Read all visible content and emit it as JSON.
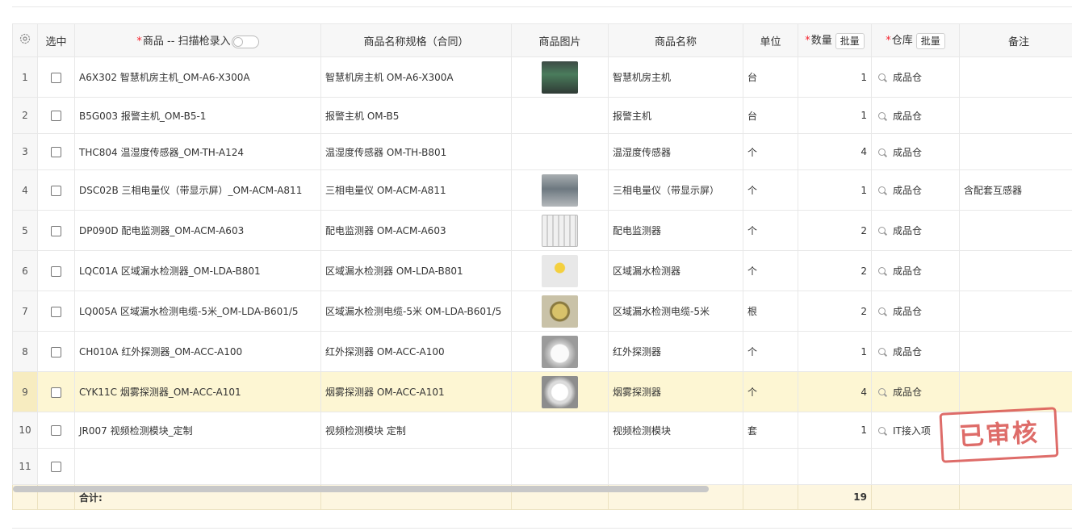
{
  "table": {
    "headers": {
      "select": "选中",
      "product_label": "商品 -- 扫描枪录入",
      "spec": "商品名称规格（合同）",
      "image": "商品图片",
      "name": "商品名称",
      "unit": "单位",
      "qty": "数量",
      "warehouse": "仓库",
      "note": "备注",
      "batch_label": "批量",
      "required_mark": "*"
    },
    "rows": [
      {
        "idx": "1",
        "product": "A6X302 智慧机房主机_OM-A6-X300A",
        "spec": "智慧机房主机 OM-A6-X300A",
        "image": "a6",
        "name": "智慧机房主机",
        "unit": "台",
        "qty": "1",
        "warehouse": "成品仓",
        "note": "",
        "checked": false
      },
      {
        "idx": "2",
        "product": "B5G003 报警主机_OM-B5-1",
        "spec": "报警主机 OM-B5",
        "image": "",
        "name": "报警主机",
        "unit": "台",
        "qty": "1",
        "warehouse": "成品仓",
        "note": "",
        "checked": false
      },
      {
        "idx": "3",
        "product": "THC804 温湿度传感器_OM-TH-A124",
        "spec": "温湿度传感器 OM-TH-B801",
        "image": "",
        "name": "温湿度传感器",
        "unit": "个",
        "qty": "4",
        "warehouse": "成品仓",
        "note": "",
        "checked": false
      },
      {
        "idx": "4",
        "product": "DSC02B 三相电量仪（带显示屏）_OM-ACM-A811",
        "spec": "三相电量仪 OM-ACM-A811",
        "image": "acm",
        "name": "三相电量仪（带显示屏）",
        "unit": "个",
        "qty": "1",
        "warehouse": "成品仓",
        "note": "含配套互感器",
        "checked": false
      },
      {
        "idx": "5",
        "product": "DP090D 配电监测器_OM-ACM-A603",
        "spec": "配电监测器 OM-ACM-A603",
        "image": "a603",
        "name": "配电监测器",
        "unit": "个",
        "qty": "2",
        "warehouse": "成品仓",
        "note": "",
        "checked": false
      },
      {
        "idx": "6",
        "product": "LQC01A 区域漏水检测器_OM-LDA-B801",
        "spec": "区域漏水检测器 OM-LDA-B801",
        "image": "b801",
        "name": "区域漏水检测器",
        "unit": "个",
        "qty": "2",
        "warehouse": "成品仓",
        "note": "",
        "checked": false
      },
      {
        "idx": "7",
        "product": "LQ005A 区域漏水检测电缆-5米_OM-LDA-B601/5",
        "spec": "区域漏水检测电缆-5米 OM-LDA-B601/5",
        "image": "b601",
        "name": "区域漏水检测电缆-5米",
        "unit": "根",
        "qty": "2",
        "warehouse": "成品仓",
        "note": "",
        "checked": false
      },
      {
        "idx": "8",
        "product": "CH010A 红外探测器_OM-ACC-A100",
        "spec": "红外探测器 OM-ACC-A100",
        "image": "a100",
        "name": "红外探测器",
        "unit": "个",
        "qty": "1",
        "warehouse": "成品仓",
        "note": "",
        "checked": false
      },
      {
        "idx": "9",
        "product": "CYK11C 烟雾探测器_OM-ACC-A101",
        "spec": "烟雾探测器 OM-ACC-A101",
        "image": "a101",
        "name": "烟雾探测器",
        "unit": "个",
        "qty": "4",
        "warehouse": "成品仓",
        "note": "",
        "checked": false,
        "highlighted": true
      },
      {
        "idx": "10",
        "product": "JR007 视频检测模块_定制",
        "spec": "视频检测模块 定制",
        "image": "",
        "name": "视频检测模块",
        "unit": "套",
        "qty": "1",
        "warehouse": "IT接入项",
        "note": "",
        "checked": false
      },
      {
        "idx": "11",
        "product": "",
        "spec": "",
        "image": "",
        "name": "",
        "unit": "",
        "qty": "",
        "warehouse": "",
        "note": "",
        "checked": false,
        "empty": true
      }
    ],
    "footer": {
      "label": "合计:",
      "qty_total": "19"
    }
  },
  "stamp": {
    "text": "已审核"
  },
  "icons": {
    "settings": "gear-icon",
    "warehouse_search": "search-icon",
    "toggle": "scan-toggle"
  },
  "colors": {
    "required": "#f5222d",
    "highlight_row": "#fdf6d3",
    "footer": "#fdf6e0",
    "stamp": "#d9534f"
  }
}
